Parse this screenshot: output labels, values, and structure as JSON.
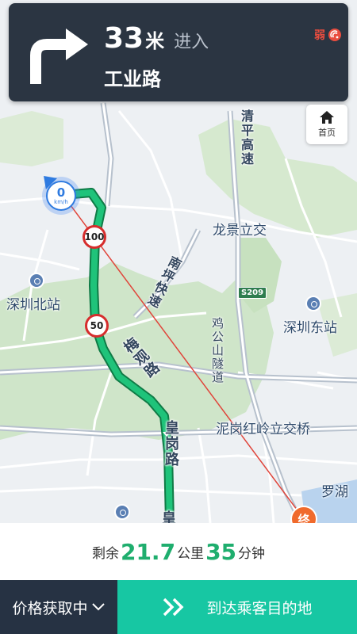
{
  "guidance": {
    "distance_value": "33",
    "distance_unit": "米",
    "action": "进入",
    "road_name": "工业路",
    "gps_signal_label": "弱"
  },
  "home_button": {
    "label": "首页"
  },
  "car_marker": {
    "speed": "0",
    "unit": "km/h"
  },
  "map": {
    "place_labels": {
      "shenzhen_north": "深圳北站",
      "shenzhen_east": "深圳东站",
      "longjing": "龙景立交",
      "nigang": "泥岗红岭立交桥",
      "luohu": "罗湖"
    },
    "road_labels": {
      "qingping": "清平高速",
      "nanping": "南坪快速",
      "jigongshan": "鸡公山隧道",
      "meiguan": "梅观路",
      "huanggang": "皇岗路",
      "huanggang_partial": "皇"
    },
    "road_shield": "S209",
    "speed_limits": [
      "100",
      "50"
    ],
    "destination_marker": "终"
  },
  "trip": {
    "remaining_prefix": "剩余",
    "distance": "21.7",
    "distance_unit": "公里",
    "time": "35",
    "time_unit": "分钟"
  },
  "bottom": {
    "price_label": "价格获取中",
    "arrive_label": "到达乘客目的地"
  },
  "colors": {
    "route": "#1fae6e",
    "accent": "#17c7a3",
    "card_dark": "#2b3542",
    "bottom_dark": "#263243",
    "direct_line": "#e0443a"
  }
}
